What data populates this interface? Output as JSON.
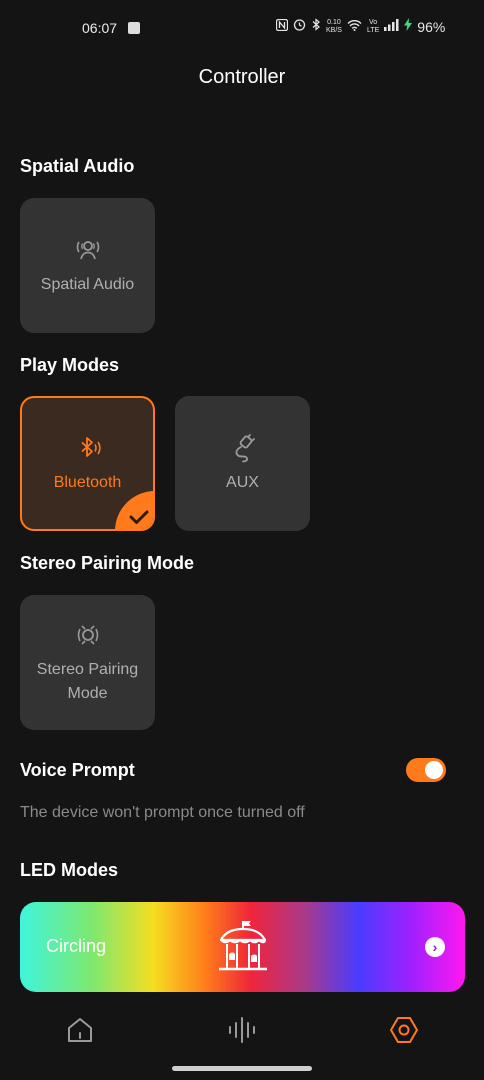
{
  "status_bar": {
    "time": "06:07",
    "net_speed_top": "0.10",
    "net_speed_bottom": "KB/S",
    "volte_top": "Vo",
    "volte_bottom": "LTE",
    "battery": "96%"
  },
  "header": {
    "title": "Controller"
  },
  "spatial_audio": {
    "section_title": "Spatial Audio",
    "tile_label": "Spatial Audio"
  },
  "play_modes": {
    "section_title": "Play Modes",
    "modes": [
      {
        "label": "Bluetooth",
        "selected": true
      },
      {
        "label": "AUX",
        "selected": false
      }
    ]
  },
  "stereo_pairing": {
    "section_title": "Stereo Pairing Mode",
    "tile_label": "Stereo Pairing Mode"
  },
  "voice_prompt": {
    "label": "Voice Prompt",
    "enabled": true,
    "description": "The device won't prompt once turned off"
  },
  "led_modes": {
    "section_title": "LED Modes",
    "current_mode": "Circling"
  },
  "colors": {
    "accent": "#ff7a1a",
    "background": "#141414",
    "tile": "#333333"
  },
  "bottom_nav": {
    "items": [
      {
        "icon": "home-icon",
        "active": false
      },
      {
        "icon": "equalizer-icon",
        "active": false
      },
      {
        "icon": "settings-hexagon-icon",
        "active": true
      }
    ]
  }
}
